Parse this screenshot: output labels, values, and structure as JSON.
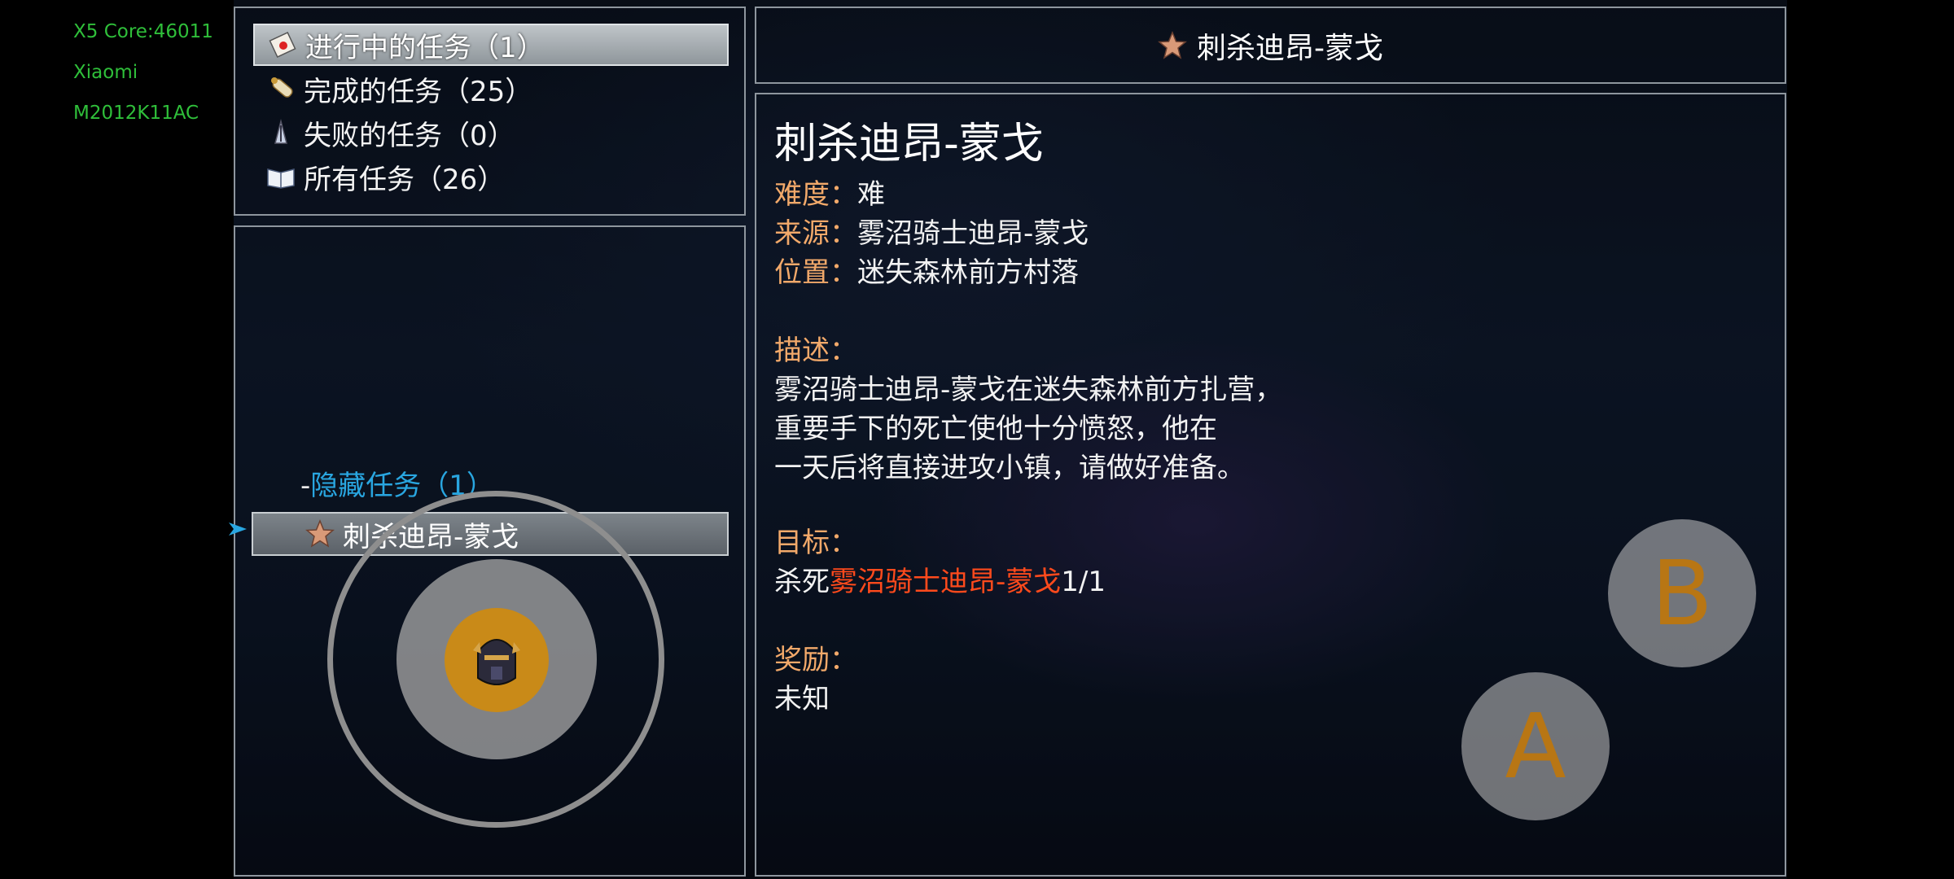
{
  "debug": [
    "X5 Core:46011",
    "Xiaomi",
    "M2012K11AC"
  ],
  "menu": [
    {
      "label": "进行中的任务（1）",
      "icon": "scroll-letter-icon",
      "selected": true
    },
    {
      "label": "完成的任务（25）",
      "icon": "rolled-scroll-icon",
      "selected": false
    },
    {
      "label": "失败的任务（0）",
      "icon": "broken-sword-icon",
      "selected": false
    },
    {
      "label": "所有任务（26）",
      "icon": "open-book-icon",
      "selected": false
    }
  ],
  "category": {
    "dash": "-",
    "label": "隐藏任务（1）"
  },
  "quest_list": [
    {
      "label": "刺杀迪昂-蒙戈",
      "icon": "star-icon"
    }
  ],
  "header": {
    "title": "刺杀迪昂-蒙戈"
  },
  "detail": {
    "title": "刺杀迪昂-蒙戈",
    "difficulty_key": "难度：",
    "difficulty": "难",
    "source_key": "来源：",
    "source": "雾沼骑士迪昂-蒙戈",
    "location_key": "位置：",
    "location": "迷失森林前方村落",
    "desc_key": "描述：",
    "desc_lines": [
      "雾沼骑士迪昂-蒙戈在迷失森林前方扎营，",
      "重要手下的死亡使他十分愤怒，他在",
      "一天后将直接进攻小镇，请做好准备。"
    ],
    "goal_key": "目标：",
    "goal_prefix": "杀死",
    "goal_target": "雾沼骑士迪昂-蒙戈",
    "goal_count": "1/1",
    "reward_key": "奖励：",
    "reward": "未知"
  },
  "controls": {
    "button_a": "A",
    "button_b": "B"
  },
  "colors": {
    "key": "#f2a96a",
    "highlight": "#ff4a1c",
    "category": "#29a6e0",
    "debug": "#2fbf3a"
  }
}
